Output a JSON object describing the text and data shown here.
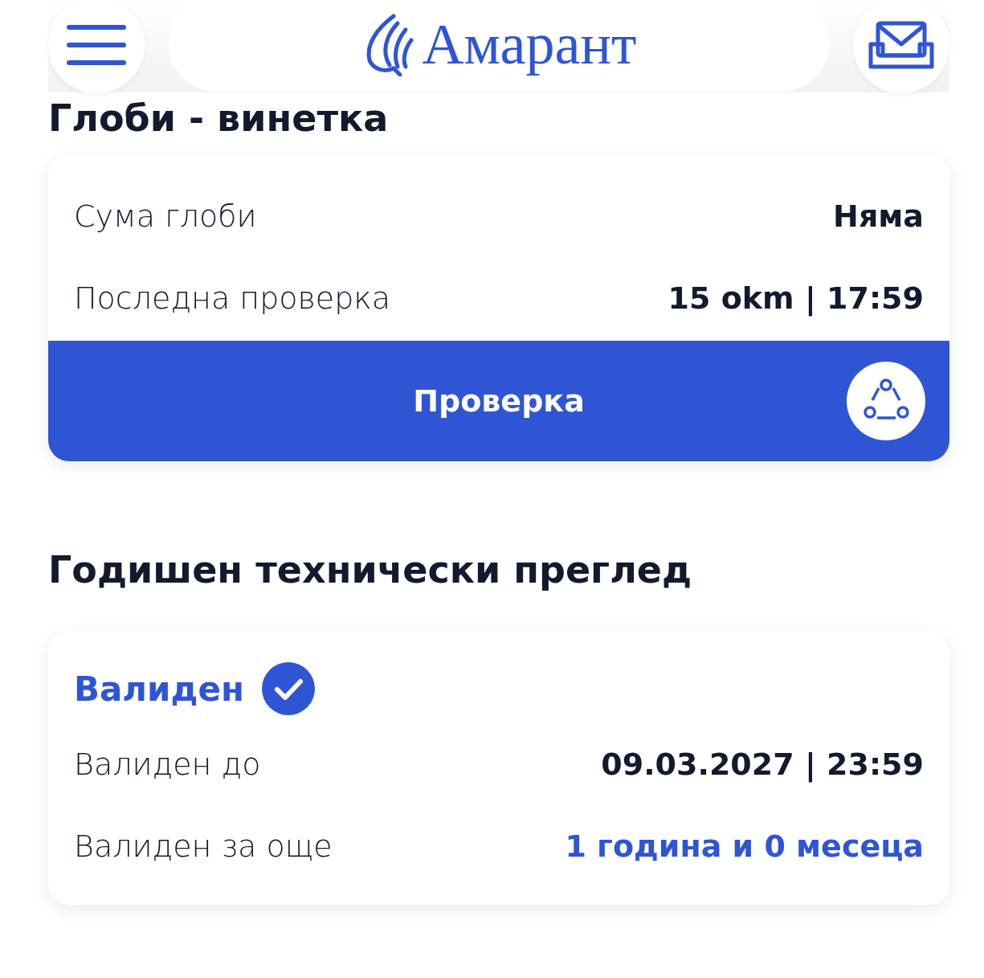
{
  "header": {
    "brand": "Амарант"
  },
  "sections": [
    {
      "title": "Глоби - винетка",
      "rows": [
        {
          "label": "Сума глоби",
          "value": "Няма",
          "highlighted": false
        },
        {
          "label": "Последна проверка",
          "value": "15 okm | 17:59",
          "highlighted": false
        }
      ],
      "action": "Проверка"
    },
    {
      "title": "Годишен технически преглед",
      "status": {
        "label": "Валиден",
        "valid": true
      },
      "rows": [
        {
          "label": "Валиден до",
          "value": "09.03.2027 | 23:59",
          "highlighted": false
        },
        {
          "label": "Валиден за още",
          "value": "1 година и 0 месеца",
          "highlighted": true
        }
      ]
    }
  ]
}
